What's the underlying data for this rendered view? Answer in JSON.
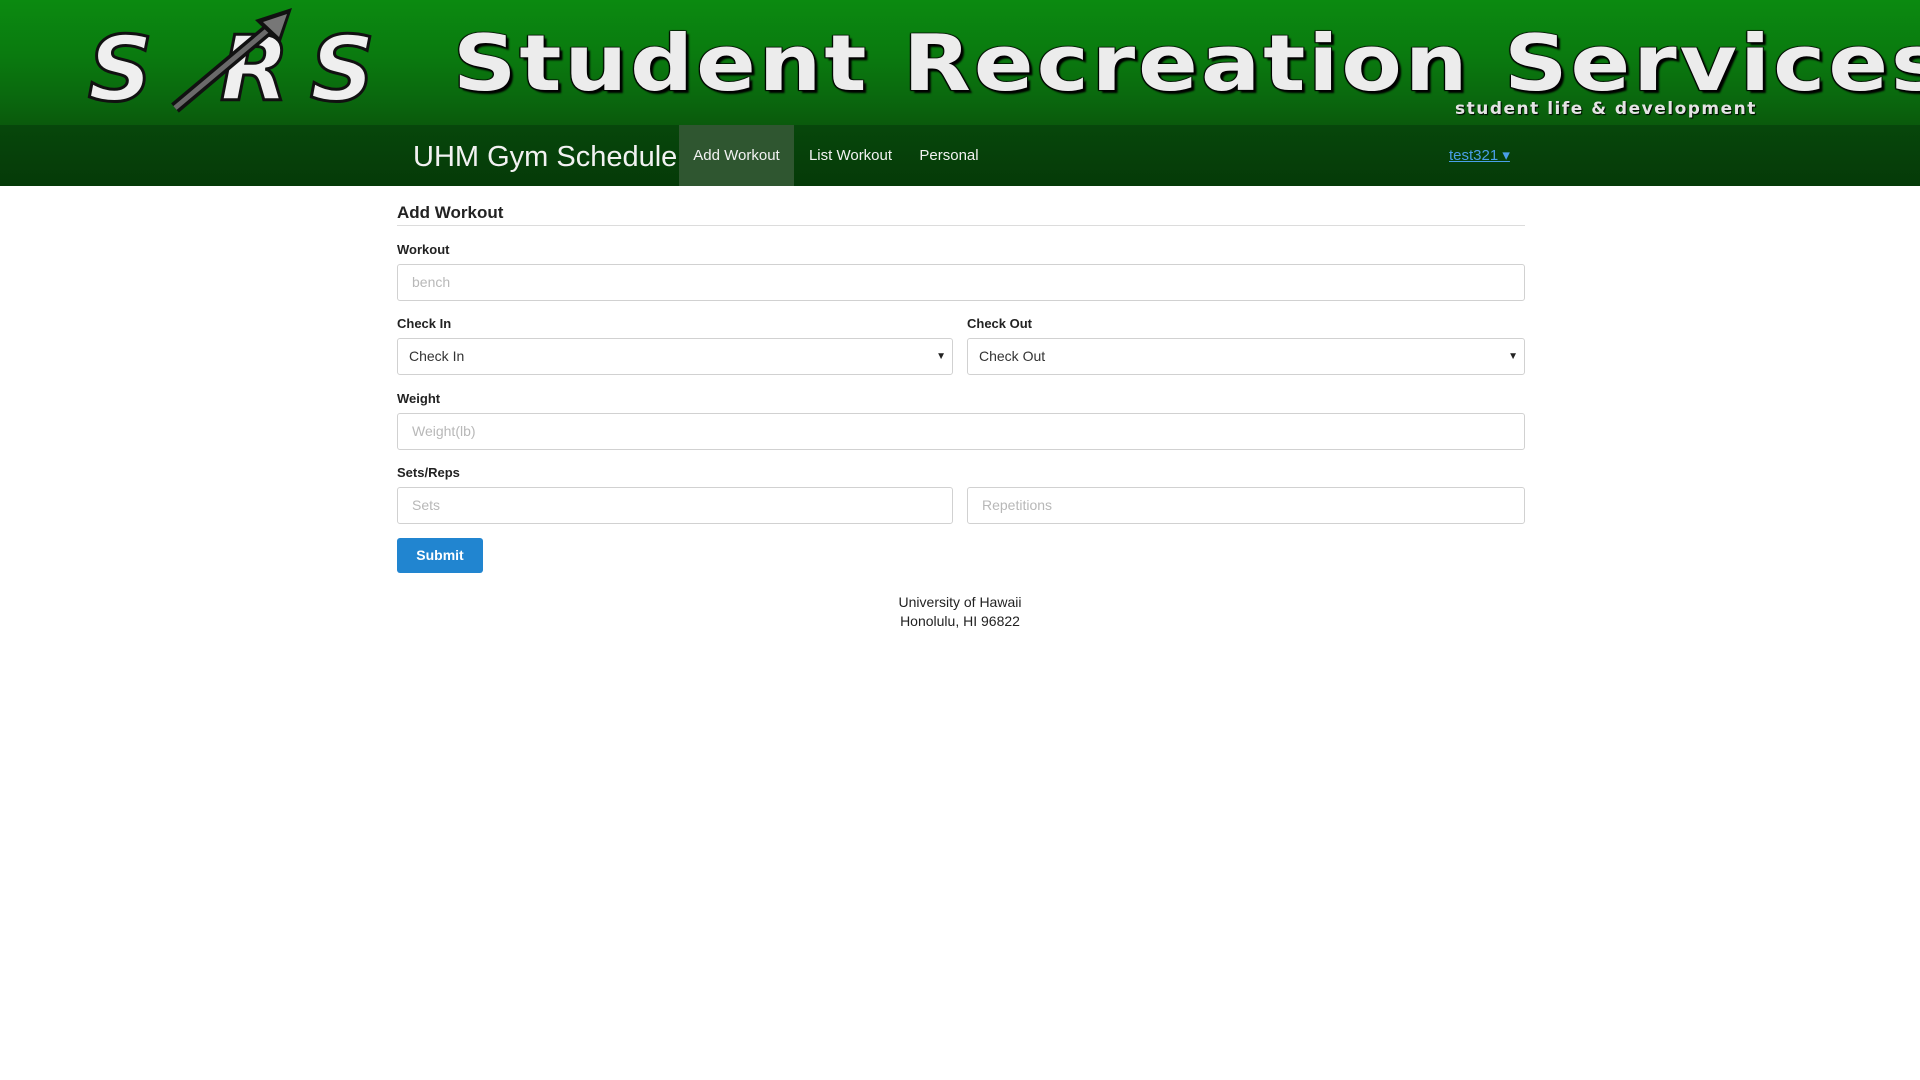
{
  "banner": {
    "logo_text": "SRS",
    "title": "Student Recreation Services",
    "subtitle": "student life & development",
    "colors": {
      "banner_green": "#0a7a0f",
      "text": "#ececec"
    }
  },
  "navbar": {
    "brand": "UHM Gym Schedule",
    "items": [
      {
        "label": "Add Workout",
        "active": true
      },
      {
        "label": "List Workout",
        "active": false
      },
      {
        "label": "Personal",
        "active": false
      }
    ],
    "user_menu": "test321 ▾",
    "colors": {
      "background": "#053a08",
      "active": "#2f5630",
      "link": "#4a9fe8"
    }
  },
  "form": {
    "title": "Add Workout",
    "workout": {
      "label": "Workout",
      "placeholder": "bench"
    },
    "check_in": {
      "label": "Check In",
      "value": "Check In"
    },
    "check_out": {
      "label": "Check Out",
      "value": "Check Out"
    },
    "weight": {
      "label": "Weight",
      "placeholder": "Weight(lb)"
    },
    "sets_reps": {
      "label": "Sets/Reps",
      "sets_placeholder": "Sets",
      "reps_placeholder": "Repetitions"
    },
    "submit_label": "Submit",
    "colors": {
      "submit": "#2185d0"
    }
  },
  "footer": {
    "line1": "University of Hawaii",
    "line2": "Honolulu, HI 96822"
  }
}
